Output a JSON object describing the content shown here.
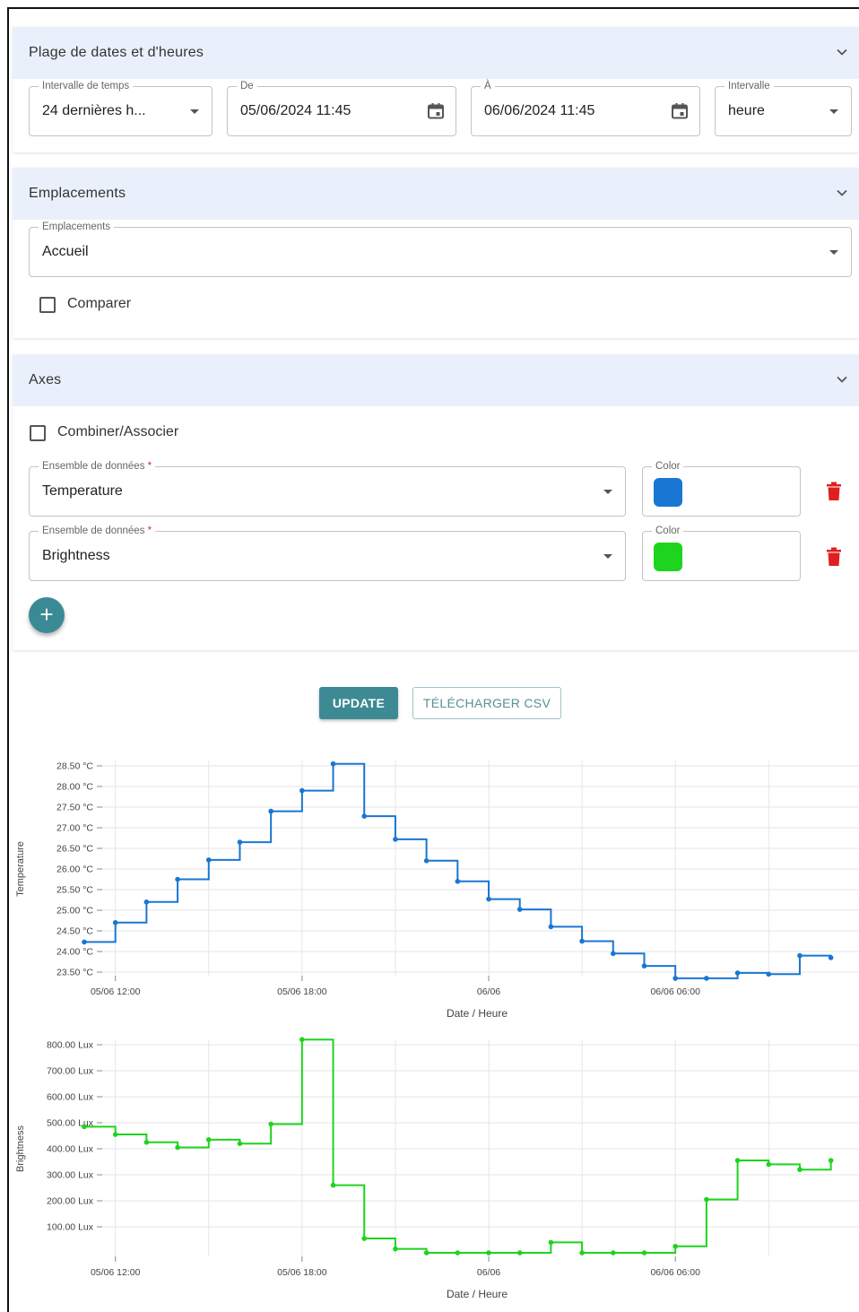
{
  "datetime_panel": {
    "title": "Plage de dates et d'heures",
    "range_label": "Intervalle de temps",
    "range_value": "24 dernières h...",
    "from_label": "De",
    "from_value": "05/06/2024 11:45",
    "to_label": "À",
    "to_value": "06/06/2024 11:45",
    "interval_label": "Intervalle",
    "interval_value": "heure"
  },
  "locations_panel": {
    "title": "Emplacements",
    "field_label": "Emplacements",
    "field_value": "Accueil",
    "compare_label": "Comparer"
  },
  "axes_panel": {
    "title": "Axes",
    "combine_label": "Combiner/Associer",
    "datasets": [
      {
        "label": "Ensemble de données",
        "required": "*",
        "value": "Temperature",
        "color_label": "Color",
        "color": "#1976d2"
      },
      {
        "label": "Ensemble de données",
        "required": "*",
        "value": "Brightness",
        "color_label": "Color",
        "color": "#1ed41e"
      }
    ],
    "add_label": "+"
  },
  "actions": {
    "update_label": "UPDATE",
    "csv_label": "TÉLÉCHARGER CSV"
  },
  "chart_data": [
    {
      "type": "line",
      "step": "after",
      "ylabel": "Temperature",
      "xlabel": "Date / Heure",
      "color": "#1976d2",
      "x_ticks": [
        "05/06 12:00",
        "05/06 18:00",
        "06/06",
        "06/06 06:00"
      ],
      "y_ticks": [
        "23.50 °C",
        "24.00 °C",
        "24.50 °C",
        "25.00 °C",
        "25.50 °C",
        "26.00 °C",
        "26.50 °C",
        "27.00 °C",
        "27.50 °C",
        "28.00 °C",
        "28.50 °C"
      ],
      "ylim": [
        23.5,
        28.5
      ],
      "xlim_hours": [
        -1,
        23.5
      ],
      "x_hours": [
        -1,
        0,
        1,
        2,
        3,
        4,
        5,
        6,
        7,
        8,
        9,
        10,
        11,
        12,
        13,
        14,
        15,
        16,
        17,
        18,
        19,
        20,
        21,
        22,
        23
      ],
      "values": [
        24.23,
        24.7,
        25.2,
        25.75,
        26.22,
        26.65,
        27.4,
        27.9,
        28.55,
        27.28,
        26.72,
        26.2,
        25.7,
        25.27,
        25.02,
        24.6,
        24.25,
        23.95,
        23.65,
        23.35,
        23.35,
        23.48,
        23.45,
        23.9,
        23.85
      ],
      "x_dates": [
        "05/06 11:00",
        "05/06 12:00",
        "05/06 13:00",
        "05/06 14:00",
        "05/06 15:00",
        "05/06 16:00",
        "05/06 17:00",
        "05/06 18:00",
        "05/06 19:00",
        "05/06 20:00",
        "05/06 21:00",
        "05/06 22:00",
        "05/06 23:00",
        "06/06 00:00",
        "06/06 01:00",
        "06/06 02:00",
        "06/06 03:00",
        "06/06 04:00",
        "06/06 05:00",
        "06/06 06:00",
        "06/06 07:00",
        "06/06 08:00",
        "06/06 09:00",
        "06/06 10:00",
        "06/06 11:00"
      ]
    },
    {
      "type": "line",
      "step": "after",
      "ylabel": "Brightness",
      "xlabel": "Date / Heure",
      "color": "#1ed41e",
      "x_ticks": [
        "05/06 12:00",
        "05/06 18:00",
        "06/06",
        "06/06 06:00"
      ],
      "y_ticks": [
        "100.00 Lux",
        "200.00 Lux",
        "300.00 Lux",
        "400.00 Lux",
        "500.00 Lux",
        "600.00 Lux",
        "700.00 Lux",
        "800.00 Lux"
      ],
      "ylim": [
        0,
        800
      ],
      "xlim_hours": [
        -1,
        23.5
      ],
      "x_hours": [
        -1,
        0,
        1,
        2,
        3,
        4,
        5,
        6,
        7,
        8,
        9,
        10,
        11,
        12,
        13,
        14,
        15,
        16,
        17,
        18,
        19,
        20,
        21,
        22,
        23
      ],
      "values": [
        485,
        455,
        425,
        405,
        435,
        420,
        495,
        820,
        260,
        55,
        15,
        0,
        0,
        0,
        0,
        40,
        0,
        0,
        0,
        25,
        205,
        355,
        340,
        320,
        355
      ],
      "x_dates": [
        "05/06 11:00",
        "05/06 12:00",
        "05/06 13:00",
        "05/06 14:00",
        "05/06 15:00",
        "05/06 16:00",
        "05/06 17:00",
        "05/06 18:00",
        "05/06 19:00",
        "05/06 20:00",
        "05/06 21:00",
        "05/06 22:00",
        "05/06 23:00",
        "06/06 00:00",
        "06/06 01:00",
        "06/06 02:00",
        "06/06 03:00",
        "06/06 04:00",
        "06/06 05:00",
        "06/06 06:00",
        "06/06 07:00",
        "06/06 08:00",
        "06/06 09:00",
        "06/06 10:00",
        "06/06 11:00"
      ]
    }
  ]
}
